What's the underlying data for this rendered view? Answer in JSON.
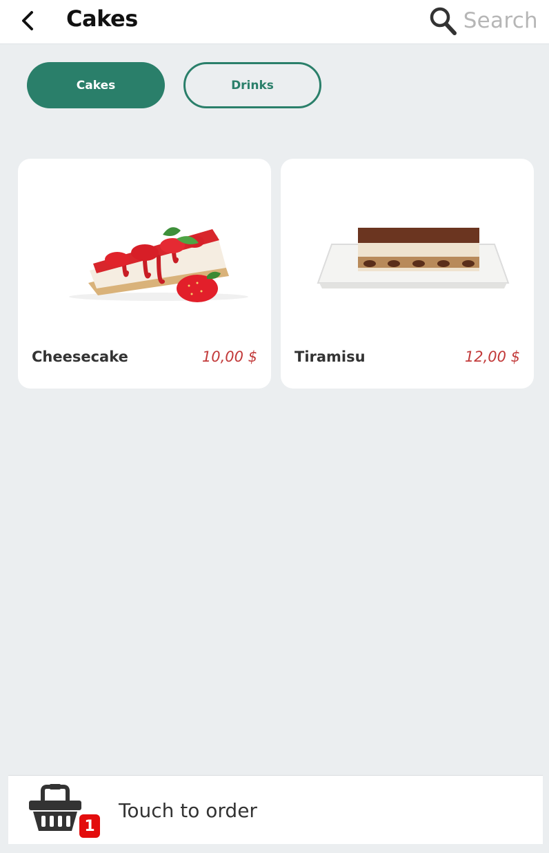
{
  "header": {
    "back_icon": "chevron-left-icon",
    "title": "Cakes",
    "search_icon": "search-icon",
    "search_placeholder": "Search"
  },
  "tabs": [
    {
      "label": "Cakes",
      "active": true
    },
    {
      "label": "Drinks",
      "active": false
    }
  ],
  "products": [
    {
      "name": "Cheesecake",
      "price": "10,00 $",
      "image": "cheesecake-slice-with-strawberries"
    },
    {
      "name": "Tiramisu",
      "price": "12,00 $",
      "image": "tiramisu-on-plate"
    }
  ],
  "order_bar": {
    "basket_icon": "basket-icon",
    "badge_count": "1",
    "label": "Touch to order"
  },
  "colors": {
    "accent": "#2a7f6a",
    "price": "#c23a3a",
    "badge": "#e30d0d",
    "background": "#ebeef0"
  }
}
